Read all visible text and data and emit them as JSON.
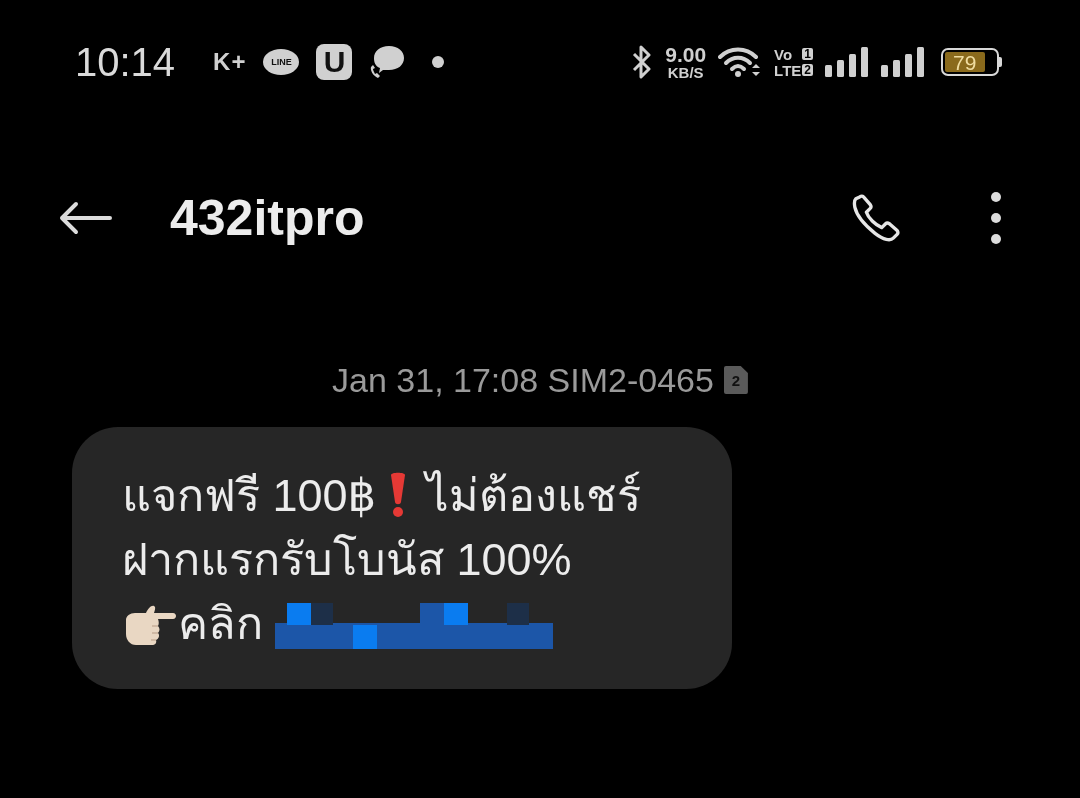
{
  "status_bar": {
    "time": "10:14",
    "notifications": [
      {
        "kind": "text_logo",
        "label": "K+"
      },
      {
        "kind": "bubble_logo",
        "label": "LINE"
      },
      {
        "kind": "tile_logo",
        "label": "U"
      },
      {
        "kind": "chat"
      },
      {
        "kind": "dot"
      }
    ],
    "net_speed": {
      "value": "9.00",
      "unit": "KB/S"
    },
    "volte": {
      "top": "Vo",
      "sim_1": "1",
      "bottom": "LTE",
      "sim_2": "2"
    },
    "battery": {
      "percent": "79"
    }
  },
  "header": {
    "title": "432itpro"
  },
  "conversation": {
    "timestamp": "Jan 31, 17:08 SIM2-0465",
    "sim_badge": "2",
    "message": {
      "line_1_start": "แจกฟรี 100฿",
      "line_1_end": "ไม่ต้องแชร์",
      "line_2": "ฝากแรกรับโบนัส 100%",
      "line_3": "คลิก"
    }
  }
}
